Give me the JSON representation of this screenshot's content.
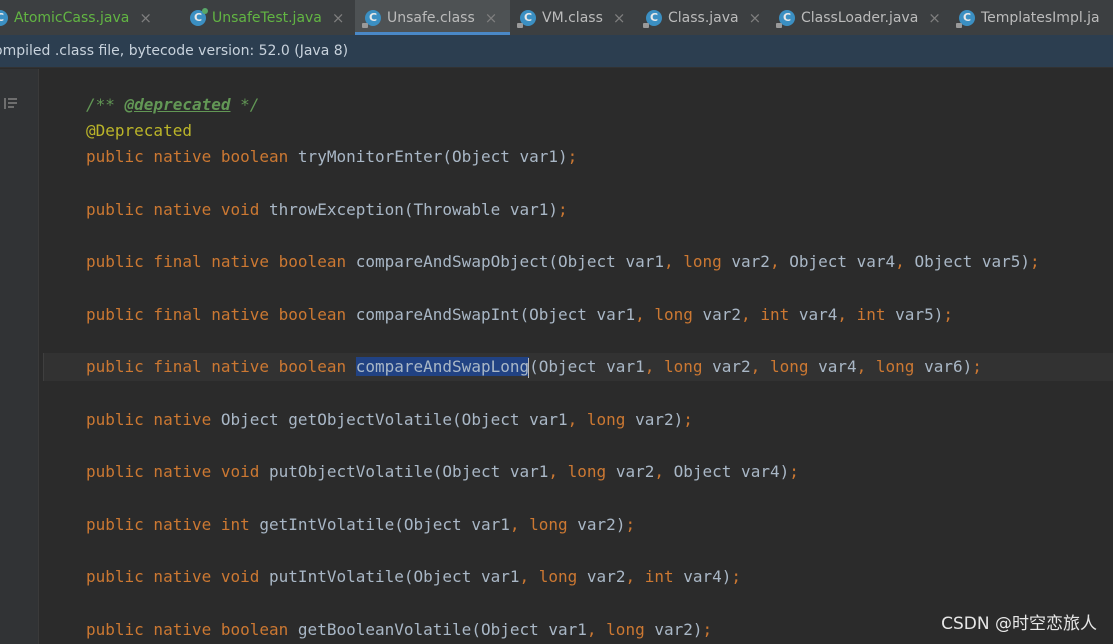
{
  "tabs": [
    {
      "label": "AtomicCass.java",
      "icon": "java-class-icon",
      "modified": true,
      "active": false,
      "badge": "none"
    },
    {
      "label": "UnsafeTest.java",
      "icon": "java-runnable-class-icon",
      "modified": true,
      "active": false,
      "badge": "run"
    },
    {
      "label": "Unsafe.class",
      "icon": "java-class-icon",
      "modified": false,
      "active": true,
      "badge": "lock"
    },
    {
      "label": "VM.class",
      "icon": "java-class-icon",
      "modified": false,
      "active": false,
      "badge": "lock"
    },
    {
      "label": "Class.java",
      "icon": "java-class-icon",
      "modified": false,
      "active": false,
      "badge": "lock"
    },
    {
      "label": "ClassLoader.java",
      "icon": "java-abstract-class-icon",
      "modified": false,
      "active": false,
      "badge": "lock"
    },
    {
      "label": "TemplatesImpl.ja",
      "icon": "java-class-icon",
      "modified": false,
      "active": false,
      "badge": "lock"
    }
  ],
  "tab_icon_letter": "C",
  "tab_close_glyph": "×",
  "banner": {
    "text": "ompiled .class file, bytecode version: 52.0 (Java 8)"
  },
  "code": {
    "lines": [
      {
        "t1": "/** ",
        "t2": "@deprecated",
        "t3": " */"
      },
      {
        "ann": "@Deprecated"
      },
      {
        "kw": "public native boolean ",
        "rest": "tryMonitorEnter(Object var1)",
        "end": ";"
      },
      {
        "kw": "public native void ",
        "rest": "throwException(Throwable var1)",
        "end": ";"
      },
      {
        "kw": "public final native boolean ",
        "name": "compareAndSwapObject",
        "args": [
          "(Object var1",
          ", ",
          "long ",
          "var2",
          ", ",
          "Object var4",
          ", ",
          "Object var5)"
        ],
        "end": ";"
      },
      {
        "kw": "public final native boolean ",
        "name": "compareAndSwapInt",
        "args": [
          "(Object var1",
          ", ",
          "long ",
          "var2",
          ", ",
          "int ",
          "var4",
          ", ",
          "int ",
          "var5)"
        ],
        "end": ";"
      },
      {
        "kw": "public final native boolean ",
        "name": "compareAndSwapLong",
        "args": [
          "(Object var1",
          ", ",
          "long ",
          "var2",
          ", ",
          "long ",
          "var4",
          ", ",
          "long ",
          "var6)"
        ],
        "end": ";"
      },
      {
        "kw": "public native ",
        "rest": "Object getObjectVolatile(Object var1",
        "p1": ", ",
        "k1": "long ",
        "r1": "var2)",
        "end": ";"
      },
      {
        "kw": "public native void ",
        "rest": "putObjectVolatile(Object var1",
        "p1": ", ",
        "k1": "long ",
        "r1": "var2",
        "p2": ", ",
        "r2": "Object var4)",
        "end": ";"
      },
      {
        "kw": "public native int ",
        "rest": "getIntVolatile(Object var1",
        "p1": ", ",
        "k1": "long ",
        "r1": "var2)",
        "end": ";"
      },
      {
        "kw": "public native void ",
        "rest": "putIntVolatile(Object var1",
        "p1": ", ",
        "k1": "long ",
        "r1": "var2",
        "p2": ", ",
        "k2": "int ",
        "r2": "var4)",
        "end": ";"
      },
      {
        "kw": "public native boolean ",
        "rest": "getBooleanVolatile(Object var1",
        "p1": ", ",
        "k1": "long ",
        "r1": "var2)",
        "end": ";"
      }
    ],
    "selected_text": "compareAndSwapLong"
  },
  "watermark": "CSDN @时空恋旅人",
  "colors": {
    "background": "#2b2b2b",
    "keyword": "#cc7832",
    "identifier": "#a9b7c6",
    "comment": "#629755",
    "annotation": "#bbb529",
    "selection": "#214283",
    "banner": "#2c3e50",
    "modified_tab": "#62b543"
  }
}
